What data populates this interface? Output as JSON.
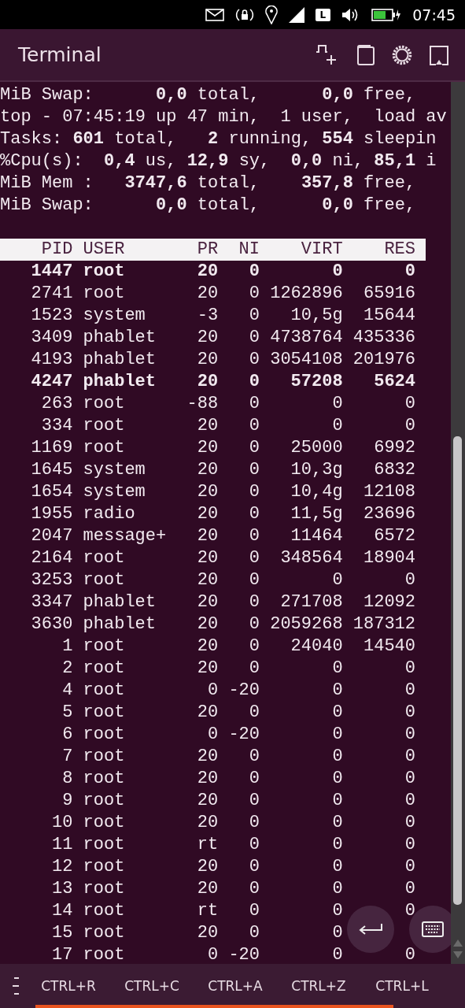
{
  "status_bar": {
    "layout": "L",
    "time": "07:45"
  },
  "window": {
    "title": "Terminal"
  },
  "terminal_lines": [
    "MiB Swap:      **0,0** total,      **0,0** free,",
    "top - 07:45:19 up 47 min,  1 user,  load av",
    "Tasks: **601** total,   **2** running, **554** sleepin",
    "%Cpu(s):  **0,4** us, **12,9** sy,  **0,0** ni, **85,1** i",
    "MiB Mem :   **3747,6** total,    **357,8** free,",
    "MiB Swap:      **0,0** total,      **0,0** free,"
  ],
  "table": {
    "columns": [
      "PID",
      "USER",
      "PR",
      "NI",
      "VIRT",
      "RES"
    ],
    "rows": [
      {
        "pid": "1447",
        "user": "root",
        "pr": "20",
        "ni": "0",
        "virt": "0",
        "res": "0",
        "bold": true
      },
      {
        "pid": "2741",
        "user": "root",
        "pr": "20",
        "ni": "0",
        "virt": "1262896",
        "res": "65916",
        "bold": false
      },
      {
        "pid": "1523",
        "user": "system",
        "pr": "-3",
        "ni": "0",
        "virt": "10,5g",
        "res": "15644",
        "bold": false
      },
      {
        "pid": "3409",
        "user": "phablet",
        "pr": "20",
        "ni": "0",
        "virt": "4738764",
        "res": "435336",
        "bold": false
      },
      {
        "pid": "4193",
        "user": "phablet",
        "pr": "20",
        "ni": "0",
        "virt": "3054108",
        "res": "201976",
        "bold": false
      },
      {
        "pid": "4247",
        "user": "phablet",
        "pr": "20",
        "ni": "0",
        "virt": "57208",
        "res": "5624",
        "bold": true
      },
      {
        "pid": "263",
        "user": "root",
        "pr": "-88",
        "ni": "0",
        "virt": "0",
        "res": "0",
        "bold": false
      },
      {
        "pid": "334",
        "user": "root",
        "pr": "20",
        "ni": "0",
        "virt": "0",
        "res": "0",
        "bold": false
      },
      {
        "pid": "1169",
        "user": "root",
        "pr": "20",
        "ni": "0",
        "virt": "25000",
        "res": "6992",
        "bold": false
      },
      {
        "pid": "1645",
        "user": "system",
        "pr": "20",
        "ni": "0",
        "virt": "10,3g",
        "res": "6832",
        "bold": false
      },
      {
        "pid": "1654",
        "user": "system",
        "pr": "20",
        "ni": "0",
        "virt": "10,4g",
        "res": "12108",
        "bold": false
      },
      {
        "pid": "1955",
        "user": "radio",
        "pr": "20",
        "ni": "0",
        "virt": "11,5g",
        "res": "23696",
        "bold": false
      },
      {
        "pid": "2047",
        "user": "message+",
        "pr": "20",
        "ni": "0",
        "virt": "11464",
        "res": "6572",
        "bold": false
      },
      {
        "pid": "2164",
        "user": "root",
        "pr": "20",
        "ni": "0",
        "virt": "348564",
        "res": "18904",
        "bold": false
      },
      {
        "pid": "3253",
        "user": "root",
        "pr": "20",
        "ni": "0",
        "virt": "0",
        "res": "0",
        "bold": false
      },
      {
        "pid": "3347",
        "user": "phablet",
        "pr": "20",
        "ni": "0",
        "virt": "271708",
        "res": "12092",
        "bold": false
      },
      {
        "pid": "3630",
        "user": "phablet",
        "pr": "20",
        "ni": "0",
        "virt": "2059268",
        "res": "187312",
        "bold": false
      },
      {
        "pid": "1",
        "user": "root",
        "pr": "20",
        "ni": "0",
        "virt": "24040",
        "res": "14540",
        "bold": false
      },
      {
        "pid": "2",
        "user": "root",
        "pr": "20",
        "ni": "0",
        "virt": "0",
        "res": "0",
        "bold": false
      },
      {
        "pid": "4",
        "user": "root",
        "pr": "0",
        "ni": "-20",
        "virt": "0",
        "res": "0",
        "bold": false
      },
      {
        "pid": "5",
        "user": "root",
        "pr": "20",
        "ni": "0",
        "virt": "0",
        "res": "0",
        "bold": false
      },
      {
        "pid": "6",
        "user": "root",
        "pr": "0",
        "ni": "-20",
        "virt": "0",
        "res": "0",
        "bold": false
      },
      {
        "pid": "7",
        "user": "root",
        "pr": "20",
        "ni": "0",
        "virt": "0",
        "res": "0",
        "bold": false
      },
      {
        "pid": "8",
        "user": "root",
        "pr": "20",
        "ni": "0",
        "virt": "0",
        "res": "0",
        "bold": false
      },
      {
        "pid": "9",
        "user": "root",
        "pr": "20",
        "ni": "0",
        "virt": "0",
        "res": "0",
        "bold": false
      },
      {
        "pid": "10",
        "user": "root",
        "pr": "20",
        "ni": "0",
        "virt": "0",
        "res": "0",
        "bold": false
      },
      {
        "pid": "11",
        "user": "root",
        "pr": "rt",
        "ni": "0",
        "virt": "0",
        "res": "0",
        "bold": false
      },
      {
        "pid": "12",
        "user": "root",
        "pr": "20",
        "ni": "0",
        "virt": "0",
        "res": "0",
        "bold": false
      },
      {
        "pid": "13",
        "user": "root",
        "pr": "20",
        "ni": "0",
        "virt": "0",
        "res": "0",
        "bold": false
      },
      {
        "pid": "14",
        "user": "root",
        "pr": "rt",
        "ni": "0",
        "virt": "0",
        "res": "0",
        "bold": false
      },
      {
        "pid": "15",
        "user": "root",
        "pr": "20",
        "ni": "0",
        "virt": "0",
        "bold": false
      },
      {
        "pid": "17",
        "user": "root",
        "pr": "0",
        "ni": "-20",
        "virt": "0",
        "res": "0",
        "bold": false
      }
    ]
  },
  "key_bar": {
    "keys": [
      "CTRL+R",
      "CTRL+C",
      "CTRL+A",
      "CTRL+Z",
      "CTRL+L"
    ]
  }
}
